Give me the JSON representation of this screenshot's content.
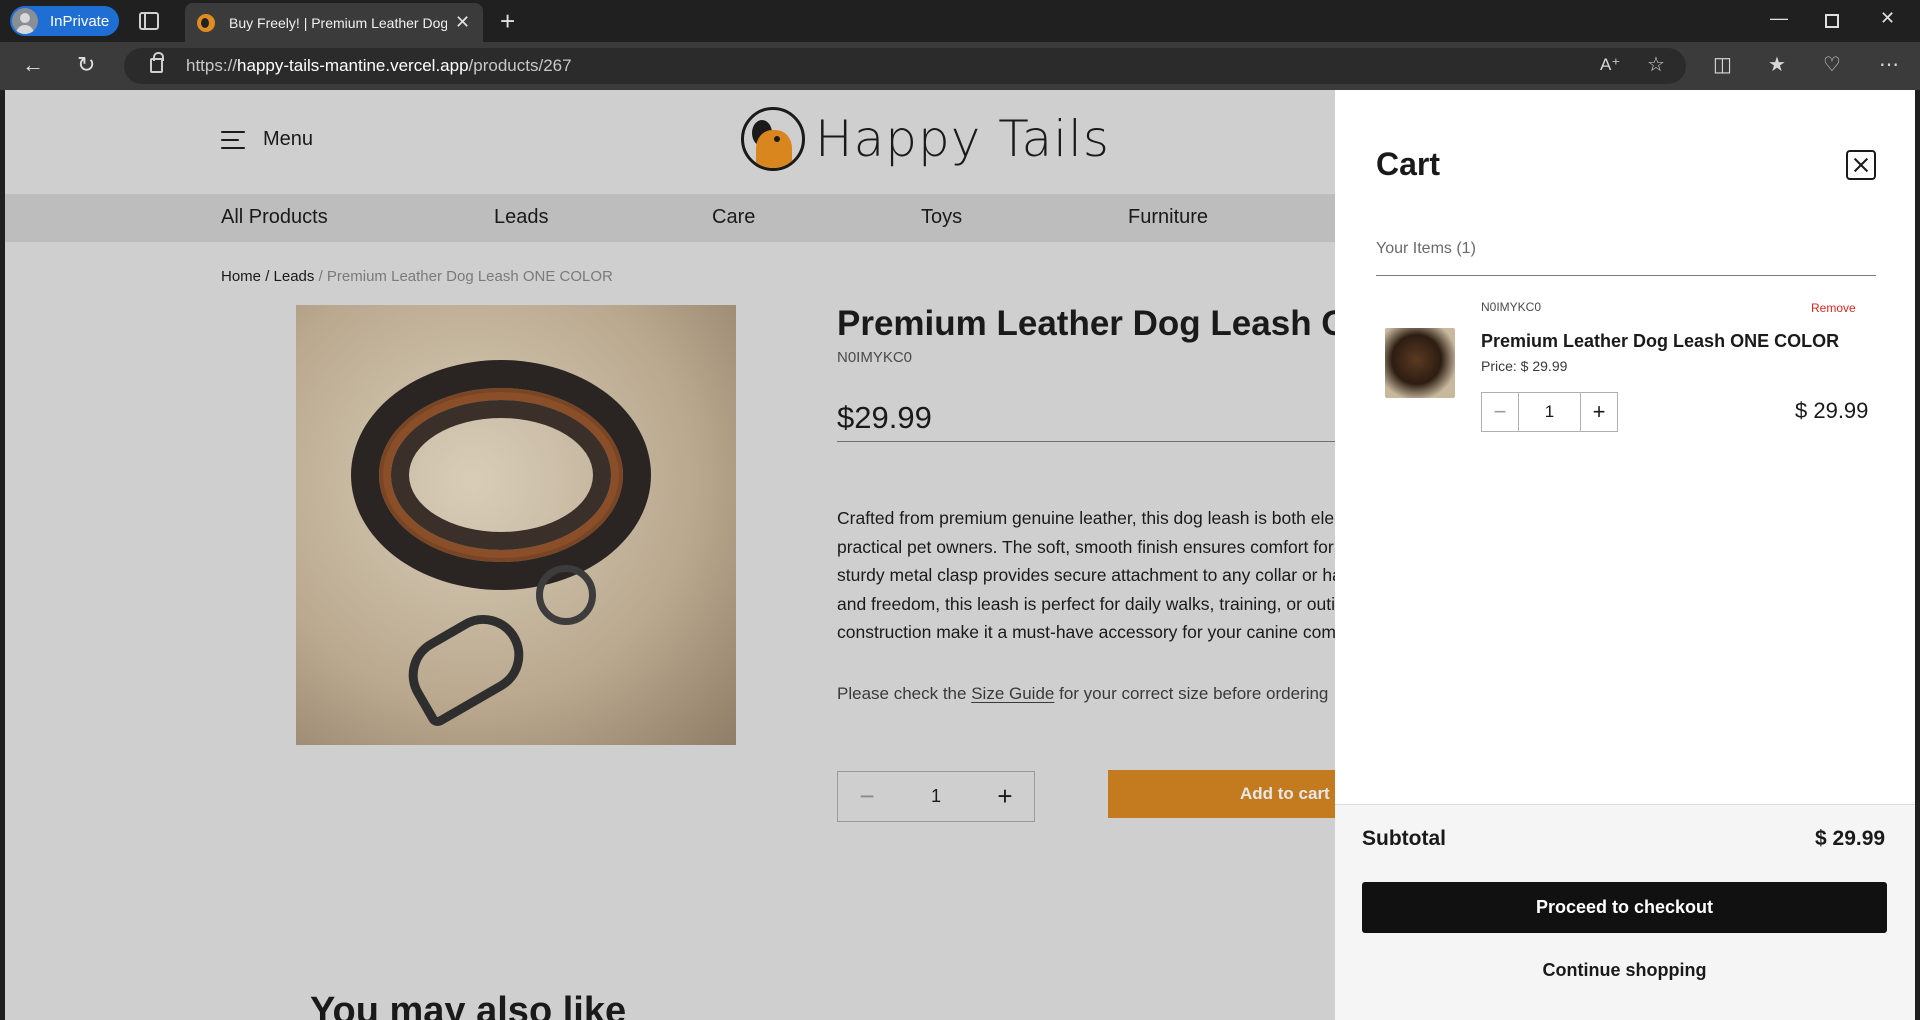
{
  "browser": {
    "inprivate_label": "InPrivate",
    "tab_title": "Buy Freely! | Premium Leather Dog Leash ONE COLOR",
    "tab_close": "✕",
    "new_tab": "+",
    "url_prefix": "https://",
    "url_host": "happy-tails-mantine.vercel.app",
    "url_path": "/products/267"
  },
  "header": {
    "menu_label": "Menu",
    "logo_text": "Happy Tails"
  },
  "categories": [
    {
      "label": "All Products"
    },
    {
      "label": "Leads"
    },
    {
      "label": "Care"
    },
    {
      "label": "Toys"
    },
    {
      "label": "Furniture"
    }
  ],
  "breadcrumb": {
    "home": "Home",
    "sep": "/",
    "category": "Leads",
    "current": "Premium Leather Dog Leash ONE COLOR"
  },
  "product": {
    "title": "Premium Leather Dog Leash ONE COLOR",
    "sku": "N0IMYKC0",
    "price": "$29.99",
    "description": [
      "Crafted from premium genuine leather, this dog leash is both elegant and durable, designed for stylish and",
      "practical pet owners. The soft, smooth finish ensures comfort for your hand during walks, while the",
      "sturdy metal clasp provides secure attachment to any collar or harness. Combining classic style with control",
      "and freedom, this leash is perfect for daily walks, training, or outings. Its timeless look and quality",
      "construction make it a must-have accessory for your canine companion."
    ],
    "size_prefix": "Please check the ",
    "size_link": "Size Guide",
    "size_suffix": " for your correct size before ordering",
    "quantity": "1",
    "minus": "−",
    "plus": "+",
    "add_to_cart": "Add to cart",
    "related_title": "You may also like"
  },
  "cart": {
    "title": "Cart",
    "your_items": "Your Items (1)",
    "items": [
      {
        "sku": "N0IMYKC0",
        "remove": "Remove",
        "name": "Premium Leather Dog Leash ONE COLOR",
        "price": "Price: $ 29.99",
        "quantity": "1",
        "minus": "−",
        "plus": "+",
        "total": "$ 29.99"
      }
    ],
    "subtotal_label": "Subtotal",
    "subtotal_value": "$ 29.99",
    "checkout_label": "Proceed to checkout",
    "continue_label": "Continue shopping"
  },
  "colors": {
    "accent": "#c47a1f",
    "remove": "#d9281e",
    "checkout_bg": "#111111"
  },
  "icons": [
    "hamburger-icon",
    "close-icon",
    "back-icon",
    "refresh-icon",
    "lock-icon",
    "star-icon",
    "favorites-icon",
    "health-icon",
    "more-icon",
    "tabs-icon",
    "read-aloud-icon",
    "split-screen-icon"
  ]
}
